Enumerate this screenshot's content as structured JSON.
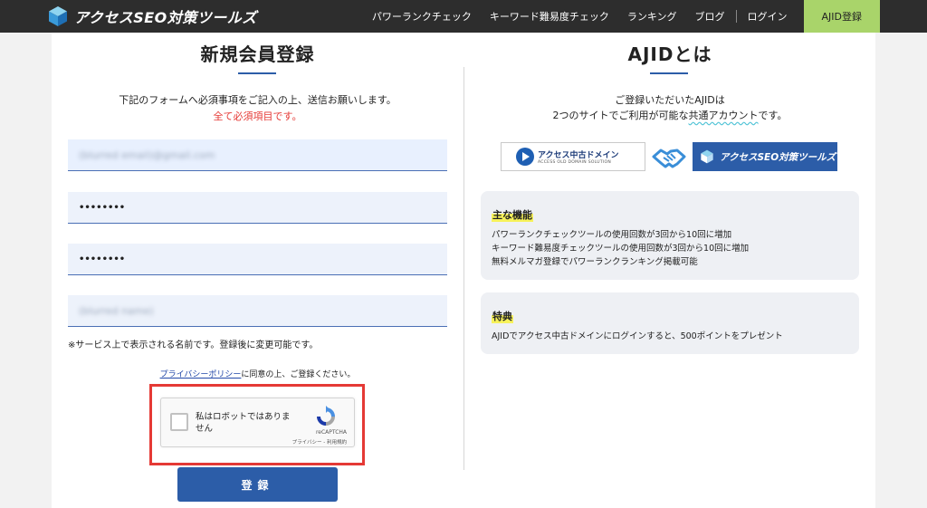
{
  "header": {
    "logo_text": "アクセスSEO対策ツールズ",
    "nav": [
      "パワーランクチェック",
      "キーワード難易度チェック",
      "ランキング",
      "ブログ",
      "ログイン"
    ],
    "cta_label": "AJID登録",
    "cta_color": "#a9d46a"
  },
  "register": {
    "title": "新規会員登録",
    "intro": "下記のフォームへ必須事項をご記入の上、送信お願いします。",
    "required_note": "全て必須項目です。",
    "email_value": "(blurred email)@gmail.com",
    "password_value": "••••••••",
    "password_confirm_value": "••••••••",
    "nickname_value": "(blurred name)",
    "name_note": "※サービス上で表示される名前です。登録後に変更可能です。",
    "policy_link": "プライバシーポリシー",
    "policy_text": "に同意の上、ご登録ください。",
    "recaptcha": {
      "label": "私はロボットではありません",
      "brand": "reCAPTCHA",
      "links": "プライバシー - 利用規約"
    },
    "submit_label": "登録",
    "accent_color": "#2c5da8",
    "highlight_color": "#e53935"
  },
  "ajid": {
    "title": "AJIDとは",
    "intro_line1": "ご登録いただいたAJIDは",
    "intro_line2_pre": "2つのサイトでご利用が可能な",
    "intro_line2_em": "共通アカウント",
    "intro_line2_post": "です。",
    "logo_a_main": "アクセス中古ドメイン",
    "logo_a_sub": "ACCESS OLD DOMAIN SOLUTION",
    "logo_b_text": "アクセスSEO対策ツールズ",
    "features": {
      "title": "主な機能",
      "items": [
        "パワーランクチェックツールの使用回数が3回から10回に増加",
        "キーワード難易度チェックツールの使用回数が3回から10回に増加",
        "無料メルマガ登録でパワーランクランキング掲載可能"
      ]
    },
    "benefits": {
      "title": "特典",
      "items": [
        "AJIDでアクセス中古ドメインにログインすると、500ポイントをプレゼント"
      ]
    }
  }
}
